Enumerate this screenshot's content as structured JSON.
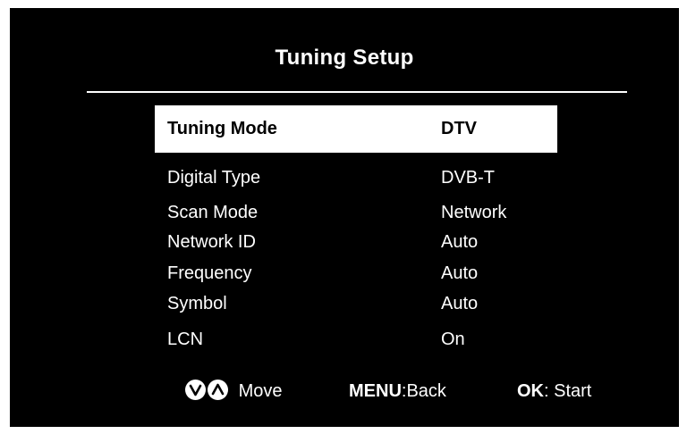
{
  "menu": {
    "title": "Tuning Setup",
    "items": [
      {
        "label": "Tuning Mode",
        "value": "DTV"
      },
      {
        "label": "Digital Type",
        "value": "DVB-T"
      },
      {
        "label": "Scan Mode",
        "value": "Network"
      },
      {
        "label": "Network ID",
        "value": "Auto"
      },
      {
        "label": "Frequency",
        "value": "Auto"
      },
      {
        "label": "Symbol",
        "value": "Auto"
      },
      {
        "label": "LCN",
        "value": "On"
      }
    ],
    "selected_index": 0
  },
  "footer": {
    "move_label": "Move",
    "menu_key": "MENU",
    "menu_action": ":Back",
    "ok_key": "OK",
    "ok_action": ": Start"
  },
  "colors": {
    "background": "#000000",
    "text": "#ffffff",
    "highlight": "#ffffff",
    "highlight_text": "#000000"
  },
  "icons": {
    "down": "chevron-down-icon",
    "up": "chevron-up-icon"
  }
}
